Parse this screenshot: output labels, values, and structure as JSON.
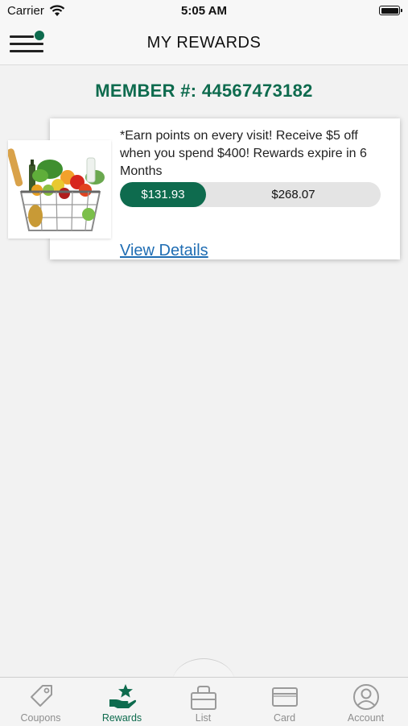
{
  "status_bar": {
    "carrier": "Carrier",
    "time": "5:05 AM"
  },
  "header": {
    "title": "MY REWARDS",
    "menu_icon": "hamburger-menu-icon"
  },
  "member": {
    "label": "MEMBER #: 44567473182"
  },
  "reward": {
    "image": "grocery-basket-image",
    "description": "*Earn points on every visit! Receive $5 off when you spend $400! Rewards expire in 6 Months",
    "earned": "$131.93",
    "remaining": "$268.07",
    "progress_fraction": 0.33,
    "link": "View Details"
  },
  "tabs": [
    {
      "label": "Coupons",
      "icon": "tag-icon",
      "active": false
    },
    {
      "label": "Rewards",
      "icon": "rewards-star-hand-icon",
      "active": true
    },
    {
      "label": "List",
      "icon": "list-basket-icon",
      "active": false
    },
    {
      "label": "Card",
      "icon": "card-icon",
      "active": false
    },
    {
      "label": "Account",
      "icon": "account-icon",
      "active": false
    }
  ],
  "colors": {
    "accent": "#0e6b4e",
    "link": "#1f6db3",
    "inactive": "#8e8e8e"
  }
}
